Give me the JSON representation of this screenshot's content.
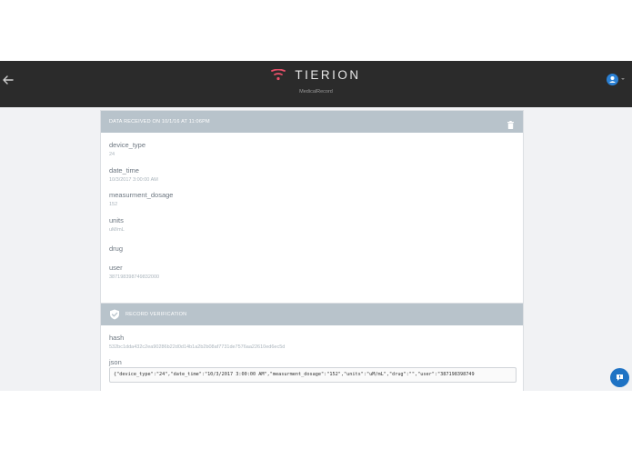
{
  "header": {
    "brand_name": "TIERION",
    "brand_sub": "MedicalRecord"
  },
  "record_card": {
    "title": "DATA RECEIVED ON 10/1/16 AT 11:06PM",
    "fields": [
      {
        "label": "device_type",
        "value": "24"
      },
      {
        "label": "date_time",
        "value": "10/3/2017 3:00:00 AM"
      },
      {
        "label": "measurment_dosage",
        "value": "152"
      },
      {
        "label": "units",
        "value": "uM/mL"
      },
      {
        "label": "drug",
        "value": ""
      },
      {
        "label": "user",
        "value": "387198398749832000"
      }
    ]
  },
  "verification_card": {
    "title": "RECORD VERIFICATION",
    "hash_label": "hash",
    "hash_value": "532bc1dda432c2ea90286b22d0d14b1a2b2b08af7731de7576aa22610ed6ec5d",
    "json_label": "json",
    "json_value": "{\"device_type\":\"24\",\"date_time\":\"10/3/2017  3:00:00 AM\",\"measurment_dosage\":\"152\",\"units\":\"uM/mL\",\"drug\":\"\",\"user\":\"387198398749"
  },
  "icons": {
    "back": "arrow-left-icon",
    "logo": "tierion-logo-icon",
    "avatar": "user-avatar-icon",
    "trash": "trash-icon",
    "shield": "shield-check-icon",
    "help": "chat-help-icon"
  },
  "colors": {
    "topbar": "#2b2b2b",
    "card_header": "#b8c3cb",
    "logo_accent": "#e8506a",
    "avatar": "#2a80d4",
    "help_button": "#1f73c4"
  }
}
